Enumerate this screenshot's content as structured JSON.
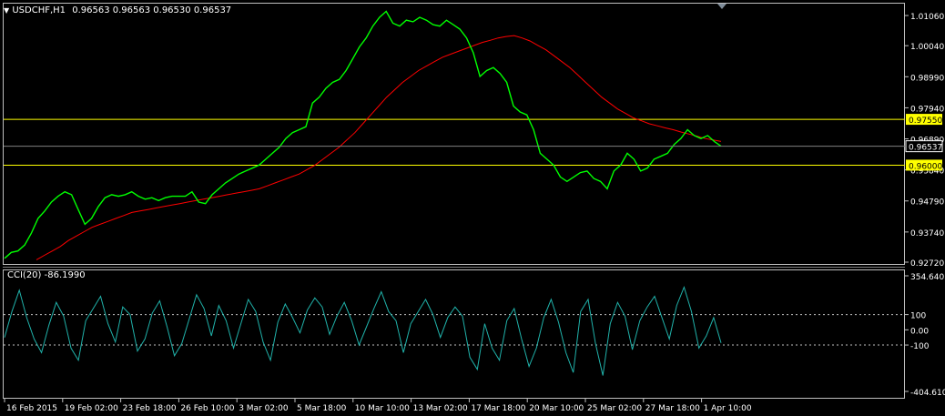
{
  "header": {
    "symbol_timeframe": "USDCHF,H1",
    "ohlc": "0.96563 0.96563 0.96530 0.96537"
  },
  "indicator": {
    "label": "CCI(20) -86.1990"
  },
  "colors": {
    "background": "#000000",
    "price_line": "#00ff00",
    "moving_average": "#ff0000",
    "hline": "#ffff00",
    "cci_line": "#20b2aa",
    "grid_text": "#ffffff",
    "current_price_box": "#000000"
  },
  "chart_data": [
    {
      "type": "line",
      "title": "USDCHF,H1",
      "y_ticks": [
        "1.01060",
        "1.00040",
        "0.98990",
        "0.97940",
        "0.96890",
        "0.95840",
        "0.94790",
        "0.93740",
        "0.92720"
      ],
      "ylim": [
        0.9272,
        1.014
      ],
      "x_ticks": [
        "16 Feb 2015",
        "19 Feb 02:00",
        "23 Feb 18:00",
        "26 Feb 10:00",
        "3 Mar 02:00",
        "5 Mar 18:00",
        "10 Mar 10:00",
        "13 Mar 02:00",
        "17 Mar 18:00",
        "20 Mar 10:00",
        "25 Mar 02:00",
        "27 Mar 18:00",
        "1 Apr 10:00"
      ],
      "series": [
        {
          "values": [
            0.9285,
            0.9305,
            0.931,
            0.933,
            0.937,
            0.942,
            0.9445,
            0.9475,
            0.9495,
            0.951,
            0.95,
            0.945,
            0.94,
            0.942,
            0.946,
            0.949,
            0.95,
            0.9495,
            0.95,
            0.951,
            0.9495,
            0.9485,
            0.949,
            0.948,
            0.949,
            0.9495,
            0.9495,
            0.9495,
            0.951,
            0.9475,
            0.947,
            0.95,
            0.952,
            0.954,
            0.9555,
            0.957,
            0.958,
            0.959,
            0.96,
            0.962,
            0.964,
            0.966,
            0.969,
            0.971,
            0.972,
            0.973,
            0.981,
            0.983,
            0.986,
            0.988,
            0.989,
            0.992,
            0.996,
            1.0,
            1.003,
            1.007,
            1.01,
            1.012,
            1.008,
            1.007,
            1.009,
            1.0085,
            1.01,
            1.009,
            1.0075,
            1.007,
            1.009,
            1.0075,
            1.006,
            1.003,
            0.998,
            0.99,
            0.992,
            0.993,
            0.991,
            0.988,
            0.98,
            0.978,
            0.977,
            0.972,
            0.964,
            0.962,
            0.96,
            0.956,
            0.9545,
            0.956,
            0.9575,
            0.958,
            0.9555,
            0.9545,
            0.952,
            0.958,
            0.96,
            0.964,
            0.962,
            0.958,
            0.959,
            0.962,
            0.963,
            0.964,
            0.967,
            0.969,
            0.972,
            0.97,
            0.969,
            0.97,
            0.968,
            0.9664
          ]
        },
        {
          "values": [
            0.928,
            0.9295,
            0.931,
            0.9325,
            0.9345,
            0.936,
            0.9375,
            0.939,
            0.94,
            0.941,
            0.942,
            0.943,
            0.944,
            0.9445,
            0.945,
            0.9455,
            0.946,
            0.9465,
            0.947,
            0.9475,
            0.948,
            0.9485,
            0.949,
            0.9495,
            0.95,
            0.9505,
            0.951,
            0.9515,
            0.952,
            0.953,
            0.954,
            0.955,
            0.956,
            0.957,
            0.9585,
            0.96,
            0.962,
            0.964,
            0.966,
            0.9685,
            0.971,
            0.974,
            0.977,
            0.98,
            0.983,
            0.9855,
            0.988,
            0.99,
            0.992,
            0.9935,
            0.995,
            0.9965,
            0.9975,
            0.9985,
            0.9995,
            1.0005,
            1.0015,
            1.0022,
            1.003,
            1.0035,
            1.0038,
            1.003,
            1.002,
            1.0005,
            0.999,
            0.997,
            0.995,
            0.993,
            0.9905,
            0.988,
            0.9855,
            0.983,
            0.981,
            0.979,
            0.9775,
            0.976,
            0.975,
            0.974,
            0.9733,
            0.9726,
            0.972,
            0.9712,
            0.9705,
            0.9698,
            0.969,
            0.9685,
            0.968
          ]
        }
      ],
      "hlines": [
        0.9755,
        0.96
      ],
      "hline_labels": [
        "0.97550",
        "0.96000"
      ],
      "current_price_label": "0.96537"
    },
    {
      "type": "line",
      "title": "CCI(20)",
      "y_ticks": [
        "354.6403",
        "100",
        "0.00",
        "-100",
        "-404.6106"
      ],
      "ylim": [
        -404.6106,
        354.6403
      ],
      "levels": [
        100,
        -100
      ],
      "series": [
        {
          "values": [
            -50,
            120,
            260,
            80,
            -60,
            -150,
            30,
            180,
            90,
            -120,
            -200,
            60,
            140,
            220,
            40,
            -80,
            150,
            100,
            -140,
            -60,
            110,
            190,
            20,
            -170,
            -90,
            70,
            230,
            140,
            -40,
            160,
            60,
            -120,
            40,
            200,
            120,
            -80,
            -200,
            50,
            170,
            80,
            -20,
            130,
            210,
            150,
            -30,
            90,
            180,
            60,
            -100,
            20,
            140,
            250,
            120,
            60,
            -150,
            40,
            120,
            200,
            100,
            -50,
            80,
            150,
            90,
            -180,
            -260,
            40,
            -120,
            -200,
            60,
            140,
            -60,
            -240,
            -120,
            80,
            200,
            50,
            -150,
            -280,
            120,
            200,
            -90,
            -300,
            40,
            180,
            90,
            -130,
            60,
            150,
            220,
            80,
            -60,
            160,
            280,
            120,
            -120,
            -40,
            80,
            -86
          ]
        }
      ]
    }
  ]
}
